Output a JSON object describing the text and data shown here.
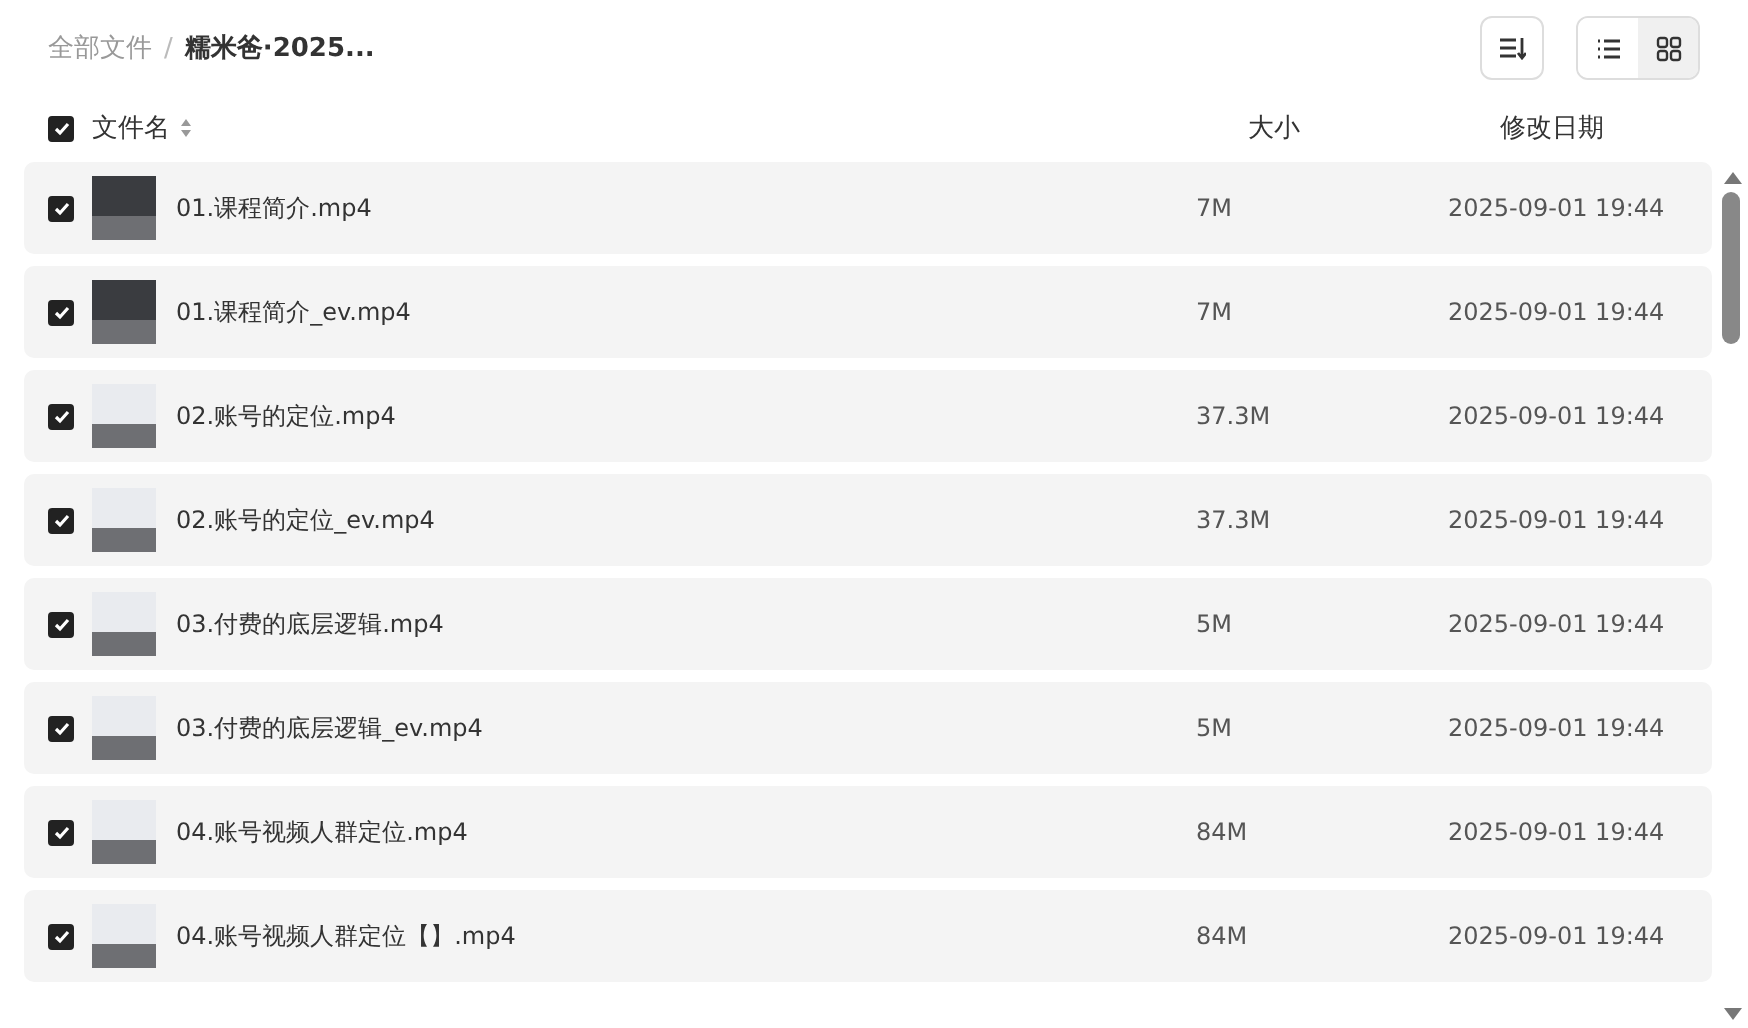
{
  "breadcrumb": [
    {
      "label": "全部文件",
      "current": false
    },
    {
      "label": "糯米爸·2025...",
      "current": true
    }
  ],
  "breadcrumb_separator": "/",
  "view_toggle": [
    {
      "kind": "list",
      "selected": false
    },
    {
      "kind": "grid",
      "selected": true
    }
  ],
  "header": {
    "checked": true,
    "name": "文件名",
    "size": "大小",
    "date": "修改日期"
  },
  "rows": [
    {
      "checked": true,
      "dark_thumbnail": true,
      "name": "01.课程简介.mp4",
      "size": "7M",
      "date": "2025-09-01 19:44"
    },
    {
      "checked": true,
      "dark_thumbnail": true,
      "name": "01.课程简介_ev.mp4",
      "size": "7M",
      "date": "2025-09-01 19:44"
    },
    {
      "checked": true,
      "dark_thumbnail": false,
      "name": "02.账号的定位.mp4",
      "size": "37.3M",
      "date": "2025-09-01 19:44"
    },
    {
      "checked": true,
      "dark_thumbnail": false,
      "name": "02.账号的定位_ev.mp4",
      "size": "37.3M",
      "date": "2025-09-01 19:44"
    },
    {
      "checked": true,
      "dark_thumbnail": false,
      "name": "03.付费的底层逻辑.mp4",
      "size": "5M",
      "date": "2025-09-01 19:44"
    },
    {
      "checked": true,
      "dark_thumbnail": false,
      "name": "03.付费的底层逻辑_ev.mp4",
      "size": "5M",
      "date": "2025-09-01 19:44"
    },
    {
      "checked": true,
      "dark_thumbnail": false,
      "name": "04.账号视频人群定位.mp4",
      "size": "84M",
      "date": "2025-09-01 19:44"
    },
    {
      "checked": true,
      "dark_thumbnail": false,
      "name": "04.账号视频人群定位【】.mp4",
      "size": "84M",
      "date": "2025-09-01 19:44"
    }
  ]
}
